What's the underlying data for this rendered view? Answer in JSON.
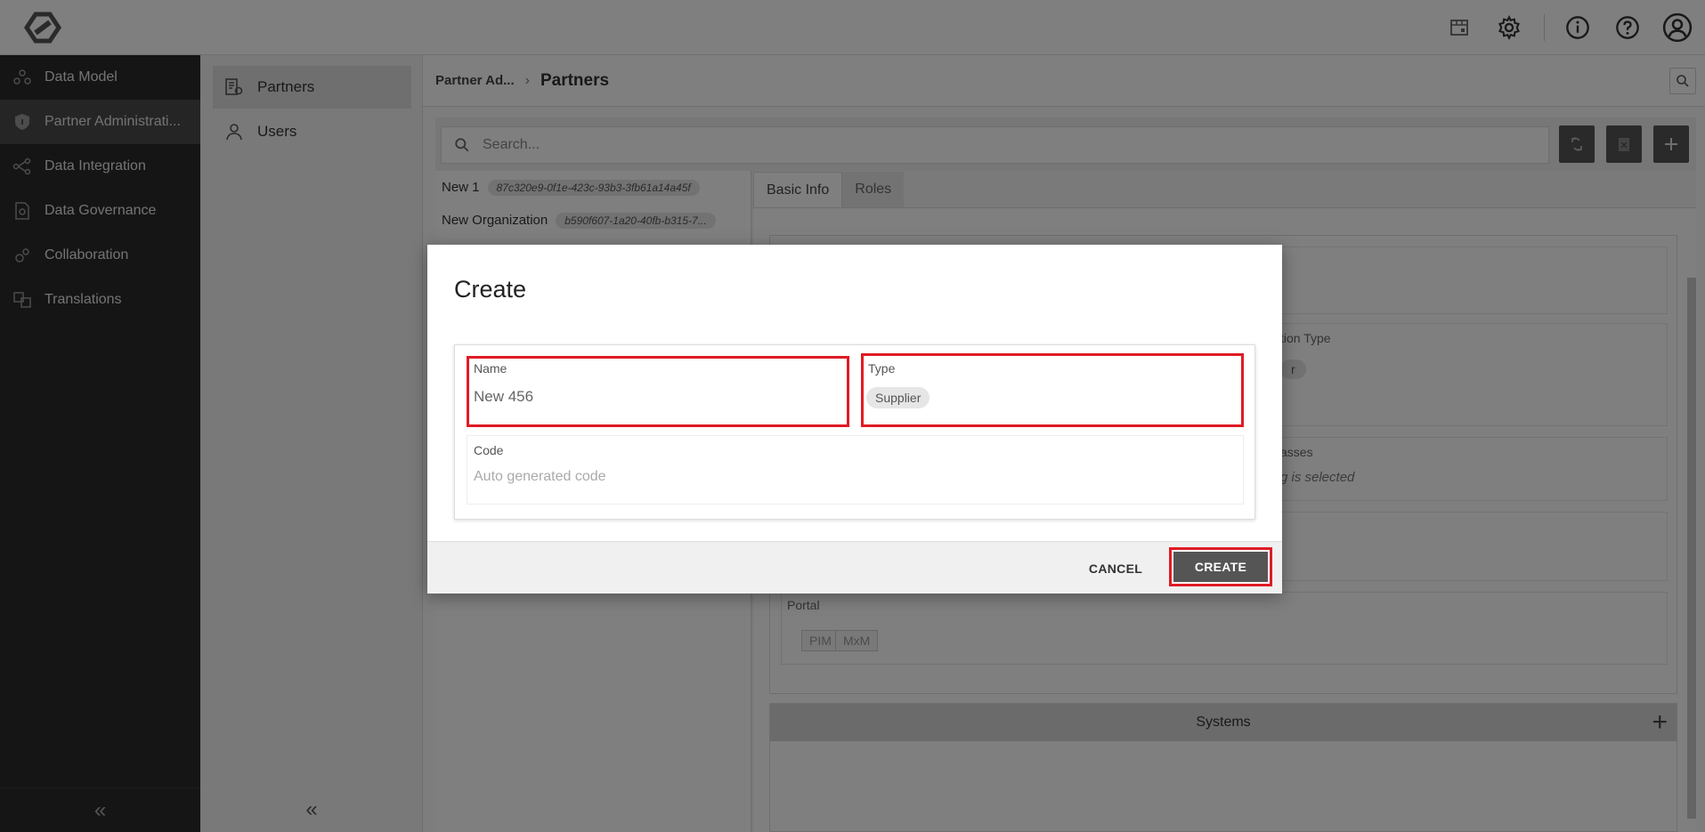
{
  "header": {
    "icons": [
      "cube-icon",
      "gear-icon",
      "info-icon",
      "help-icon",
      "user-icon"
    ]
  },
  "leftnav": {
    "items": [
      {
        "label": "Data Model",
        "icon": "data-model-icon"
      },
      {
        "label": "Partner Administrati...",
        "icon": "shield-icon",
        "active": true
      },
      {
        "label": "Data Integration",
        "icon": "integration-icon"
      },
      {
        "label": "Data Governance",
        "icon": "governance-icon"
      },
      {
        "label": "Collaboration",
        "icon": "collaboration-icon"
      },
      {
        "label": "Translations",
        "icon": "translations-icon"
      }
    ],
    "collapse": "«"
  },
  "subnav": {
    "items": [
      {
        "label": "Partners",
        "icon": "partners-icon",
        "active": true
      },
      {
        "label": "Users",
        "icon": "user-icon"
      }
    ],
    "collapse": "«"
  },
  "breadcrumb": {
    "parent": "Partner Ad...",
    "separator": "›",
    "current": "Partners"
  },
  "search": {
    "placeholder": "Search..."
  },
  "list": [
    {
      "name": "New 1",
      "id": "87c320e9-0f1e-423c-93b3-3fb61a14a45f"
    },
    {
      "name": "New Organization",
      "id": "b590f607-1a20-40fb-b315-7..."
    }
  ],
  "detail": {
    "tabs": [
      "Basic Info",
      "Roles"
    ],
    "org_type_label": "tion Type",
    "org_type_chip": "r",
    "classes_label": "asses",
    "classes_hint": "g is selected",
    "portal_label": "Portal",
    "portal_chips": [
      "PIM",
      "MxM"
    ],
    "systems_title": "Systems"
  },
  "modal": {
    "title": "Create",
    "name_label": "Name",
    "name_value": "New 456",
    "type_label": "Type",
    "type_value": "Supplier",
    "code_label": "Code",
    "code_placeholder": "Auto generated code",
    "cancel_label": "CANCEL",
    "create_label": "CREATE"
  },
  "colors": {
    "highlight": "#e01b24",
    "nav_bg": "#2b2b2b",
    "button_dark": "#555555"
  }
}
